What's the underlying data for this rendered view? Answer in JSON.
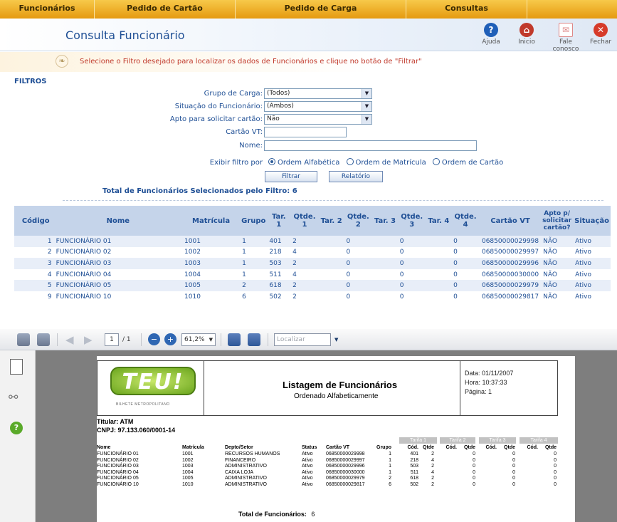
{
  "nav": {
    "items": [
      {
        "label": "Funcionários",
        "w": 133
      },
      {
        "label": "Pedido de Cartão",
        "w": 198
      },
      {
        "label": "Pedido de Carga",
        "w": 240
      },
      {
        "label": "Consultas",
        "w": 170
      }
    ]
  },
  "header": {
    "title": "Consulta Funcionário",
    "buttons": [
      {
        "label": "Ajuda",
        "icon": "help-icon",
        "color": "#1f5fb8"
      },
      {
        "label": "Inicio",
        "icon": "home-icon",
        "color": "#c0392b"
      },
      {
        "label": "Fale conosco",
        "icon": "mail-icon",
        "color": "#d88"
      },
      {
        "label": "Fechar",
        "icon": "close-icon",
        "color": "#d63b2a"
      }
    ]
  },
  "instruction": "Selecione o Filtro desejado para localizar os dados de Funcionários e clique no botão de \"Filtrar\"",
  "filters": {
    "title": "FILTROS",
    "grupo_label": "Grupo de Carga:",
    "grupo_value": "(Todos)",
    "situacao_label": "Situação do Funcionário:",
    "situacao_value": "(Ambos)",
    "apto_label": "Apto para solicitar cartão:",
    "apto_value": "Não",
    "cartao_label": "Cartão VT:",
    "nome_label": "Nome:",
    "exibir_label": "Exibir filtro por",
    "order_options": [
      "Ordem Alfabética",
      "Ordem de Matrícula",
      "Ordem de Cartão"
    ],
    "filtrar_label": "Filtrar",
    "relatorio_label": "Relatório",
    "total_text": "Total de Funcionários Selecionados pelo Filtro: 6"
  },
  "grid": {
    "columns": [
      "Código",
      "Nome",
      "Matrícula",
      "Grupo",
      "Tar. 1",
      "Qtde. 1",
      "Tar. 2",
      "Qtde. 2",
      "Tar. 3",
      "Qtde. 3",
      "Tar. 4",
      "Qtde. 4",
      "Cartão VT",
      "Apto p/ solicitar cartão?",
      "Situação"
    ],
    "rows": [
      [
        "1",
        "FUNCIONÁRIO 01",
        "1001",
        "1",
        "401",
        "2",
        "",
        "0",
        "",
        "0",
        "",
        "0",
        "06850000029998",
        "NÃO",
        "Ativo"
      ],
      [
        "2",
        "FUNCIONÁRIO 02",
        "1002",
        "1",
        "218",
        "4",
        "",
        "0",
        "",
        "0",
        "",
        "0",
        "06850000029997",
        "NÃO",
        "Ativo"
      ],
      [
        "3",
        "FUNCIONÁRIO 03",
        "1003",
        "1",
        "503",
        "2",
        "",
        "0",
        "",
        "0",
        "",
        "0",
        "06850000029996",
        "NÃO",
        "Ativo"
      ],
      [
        "4",
        "FUNCIONÁRIO 04",
        "1004",
        "1",
        "511",
        "4",
        "",
        "0",
        "",
        "0",
        "",
        "0",
        "06850000030000",
        "NÃO",
        "Ativo"
      ],
      [
        "5",
        "FUNCIONÁRIO 05",
        "1005",
        "2",
        "618",
        "2",
        "",
        "0",
        "",
        "0",
        "",
        "0",
        "06850000029979",
        "NÃO",
        "Ativo"
      ],
      [
        "9",
        "FUNCIONÁRIO 10",
        "1010",
        "6",
        "502",
        "2",
        "",
        "0",
        "",
        "0",
        "",
        "0",
        "06850000029817",
        "NÃO",
        "Ativo"
      ]
    ]
  },
  "viewer": {
    "page_current": "1",
    "page_total": "/ 1",
    "zoom": "61,2%",
    "search_placeholder": "Localizar"
  },
  "report": {
    "logo_text": "TEU!",
    "logo_sub": "BILHETE METROPOLITANO",
    "title": "Listagem de Funcionários",
    "subtitle": "Ordenado Alfabeticamente",
    "data": "Data:  01/11/2007",
    "hora": "Hora:  10:37:33",
    "pagina": "Página:  1",
    "titular": "Titular:  ATM",
    "cnpj": "CNPJ:   97.133.060/0001-14",
    "tarifas": [
      "Tarifa 1",
      "Tarifa 2",
      "Tarifa 3",
      "Tarifa 4"
    ],
    "columns": [
      "Nome",
      "Matrícula",
      "Depto/Setor",
      "Status",
      "Cartão VT",
      "Grupo",
      "Cód.",
      "Qtde",
      "Cód.",
      "Qtde",
      "Cód.",
      "Qtde",
      "Cód.",
      "Qtde"
    ],
    "rows": [
      [
        "FUNCIONÁRIO 01",
        "1001",
        "RECURSOS HUMANOS",
        "Ativo",
        "06850000029998",
        "1",
        "401",
        "2",
        "",
        "0",
        "",
        "0",
        "",
        "0"
      ],
      [
        "FUNCIONÁRIO 02",
        "1002",
        "FINANCEIRO",
        "Ativo",
        "06850000029997",
        "1",
        "218",
        "4",
        "",
        "0",
        "",
        "0",
        "",
        "0"
      ],
      [
        "FUNCIONÁRIO 03",
        "1003",
        "ADMINISTRATIVO",
        "Ativo",
        "06850000029996",
        "1",
        "503",
        "2",
        "",
        "0",
        "",
        "0",
        "",
        "0"
      ],
      [
        "FUNCIONÁRIO 04",
        "1004",
        "CAIXA LOJA",
        "Ativo",
        "06850000030000",
        "1",
        "511",
        "4",
        "",
        "0",
        "",
        "0",
        "",
        "0"
      ],
      [
        "FUNCIONÁRIO 05",
        "1005",
        "ADMINISTRATIVO",
        "Ativo",
        "06850000029979",
        "2",
        "618",
        "2",
        "",
        "0",
        "",
        "0",
        "",
        "0"
      ],
      [
        "FUNCIONÁRIO 10",
        "1010",
        "ADMINISTRATIVO",
        "Ativo",
        "06850000029817",
        "6",
        "502",
        "2",
        "",
        "0",
        "",
        "0",
        "",
        "0"
      ]
    ],
    "total_label": "Total de Funcionários:",
    "total_value": "6"
  }
}
